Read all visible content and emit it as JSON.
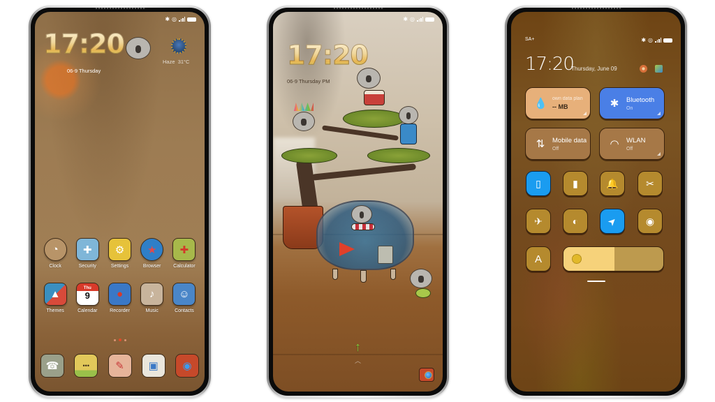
{
  "status_bar": {
    "icons": [
      "bluetooth-icon",
      "alarm-icon",
      "signal-icon",
      "battery-icon"
    ]
  },
  "home_screen": {
    "clock": "17:20",
    "date": "06-9 Thursday",
    "weather": {
      "condition": "Haze",
      "temperature": "31°C"
    },
    "apps": [
      {
        "label": "Clock",
        "icon": "clock-icon",
        "glyph": "◔",
        "color": "#b89468"
      },
      {
        "label": "Security",
        "icon": "security-icon",
        "glyph": "✚",
        "color": "#7fb6d8"
      },
      {
        "label": "Settings",
        "icon": "settings-icon",
        "glyph": "🔧",
        "color": "#e6c23a"
      },
      {
        "label": "Browser",
        "icon": "browser-icon",
        "glyph": "★",
        "color": "#2f7fc8"
      },
      {
        "label": "Calculator",
        "icon": "calculator-icon",
        "glyph": "✚",
        "color": "#a7b84a"
      },
      {
        "label": "Themes",
        "icon": "themes-icon",
        "glyph": "▲",
        "color": "#3a8fc0"
      },
      {
        "label": "Calendar",
        "icon": "calendar-icon",
        "glyph": "9",
        "color": "#ffffff",
        "header": "Thu"
      },
      {
        "label": "Recorder",
        "icon": "recorder-icon",
        "glyph": "●",
        "color": "#3a78c6"
      },
      {
        "label": "Music",
        "icon": "music-icon",
        "glyph": "♪",
        "color": "#c8b49c"
      },
      {
        "label": "Contacts",
        "icon": "contacts-icon",
        "glyph": "☺",
        "color": "#4a86c8"
      }
    ],
    "page_indicator": {
      "pages": 3,
      "active": 1
    },
    "dock": [
      {
        "icon": "phone-koala-icon",
        "glyph": "☎",
        "color": "#9aa08a"
      },
      {
        "icon": "messages-icon",
        "glyph": "•••",
        "color": "#e2c85a"
      },
      {
        "icon": "notes-icon",
        "glyph": "✎",
        "color": "#e6b49a"
      },
      {
        "icon": "gallery-icon",
        "glyph": "▣",
        "color": "#eae6dc"
      },
      {
        "icon": "camera-icon",
        "glyph": "◉",
        "color": "#c6492a"
      }
    ]
  },
  "lock_screen": {
    "clock": "17:20",
    "date": "06-9 Thursday PM",
    "swipe_hint": "↑",
    "chevron": "︿"
  },
  "control_center": {
    "carrier": "SA+",
    "time": "17:20",
    "date": "Thursday, June 09",
    "tiles": [
      {
        "id": "data-plan",
        "title": "own data plan",
        "subtitle": "-- MB",
        "icon": "water-drop-icon",
        "glyph": "💧",
        "state": "off"
      },
      {
        "id": "bluetooth",
        "title": "Bluetooth",
        "subtitle": "On",
        "icon": "bluetooth-icon",
        "glyph": "✱",
        "state": "on"
      },
      {
        "id": "mobile-data",
        "title": "Mobile data",
        "subtitle": "Off",
        "icon": "mobile-data-icon",
        "glyph": "⇅",
        "state": "off"
      },
      {
        "id": "wlan",
        "title": "WLAN",
        "subtitle": "Off",
        "icon": "wifi-icon",
        "glyph": "◠",
        "state": "off"
      }
    ],
    "quick_toggles": [
      {
        "id": "vibrate",
        "icon": "vibrate-icon",
        "glyph": "▯",
        "on": true
      },
      {
        "id": "flashlight",
        "icon": "flashlight-icon",
        "glyph": "▮",
        "on": false
      },
      {
        "id": "notifications",
        "icon": "bell-icon",
        "glyph": "🔔",
        "on": false
      },
      {
        "id": "screenshot",
        "icon": "screenshot-icon",
        "glyph": "✂",
        "on": false
      },
      {
        "id": "airplane",
        "icon": "airplane-icon",
        "glyph": "✈",
        "on": false
      },
      {
        "id": "dark-mode",
        "icon": "dark-mode-icon",
        "glyph": "◐",
        "on": false
      },
      {
        "id": "location",
        "icon": "location-icon",
        "glyph": "➤",
        "on": true
      },
      {
        "id": "reading-mode",
        "icon": "eye-icon",
        "glyph": "◉",
        "on": false
      }
    ],
    "auto_brightness_label": "A",
    "brightness_percent": 51
  }
}
